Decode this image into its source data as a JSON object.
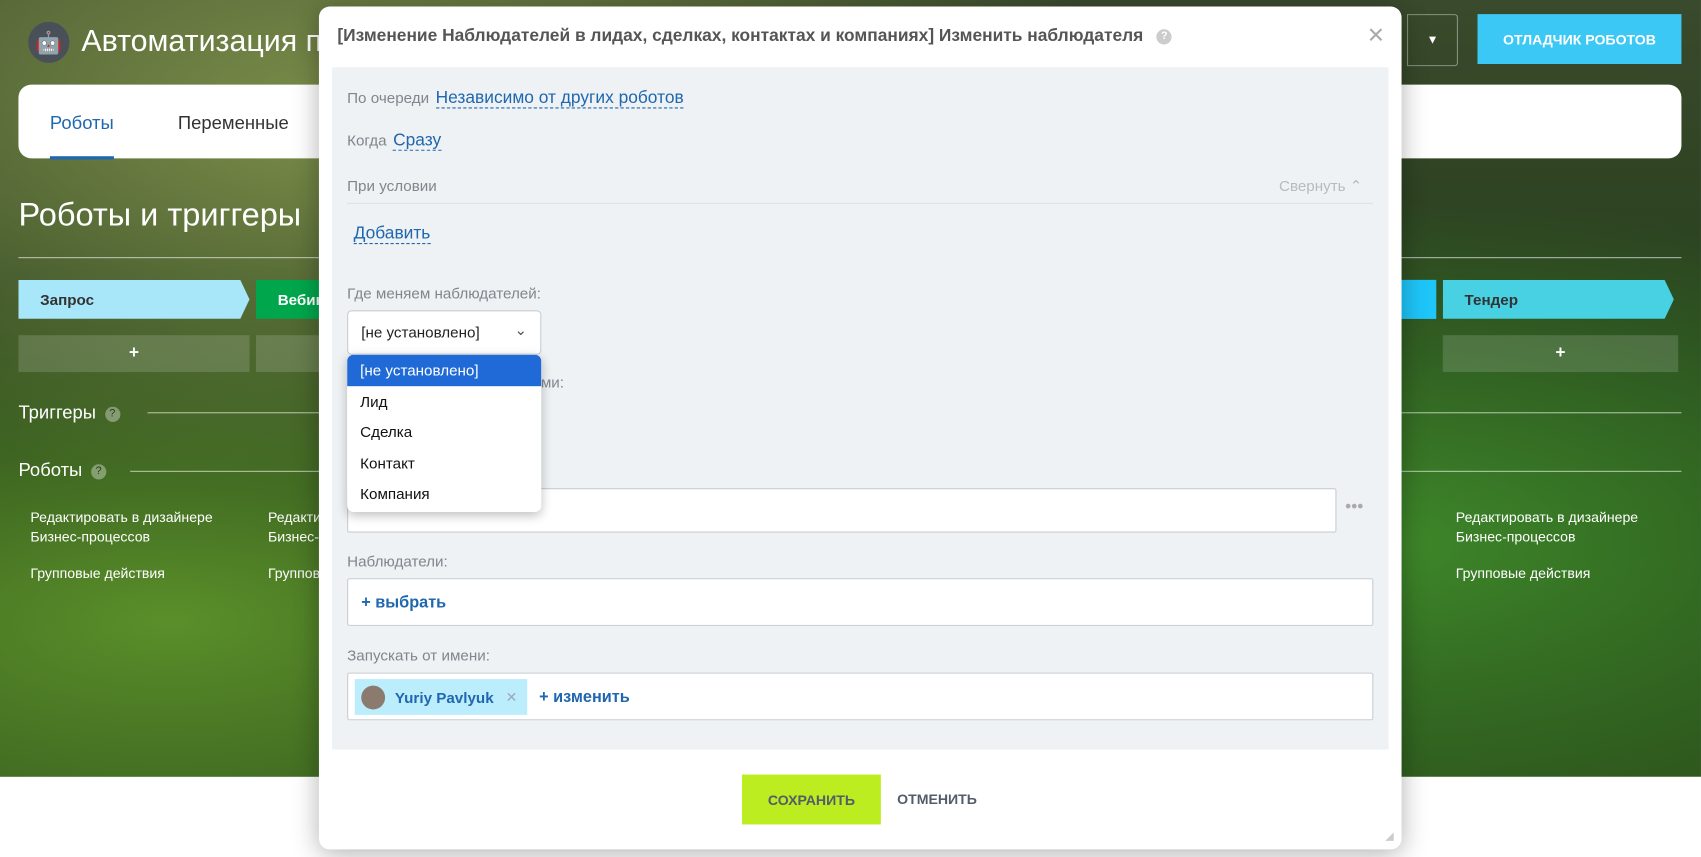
{
  "app": {
    "title": "Автоматизация пр",
    "debug_button": "ОТЛАДЧИК РОБОТОВ",
    "tabs": [
      "Роботы",
      "Переменные"
    ],
    "heading": "Роботы и триггеры"
  },
  "stages": [
    "Запрос",
    "Вебин",
    "Тендер"
  ],
  "sections": {
    "triggers": "Триггеры",
    "robots": "Роботы"
  },
  "column_links": {
    "edit": "Редактировать в дизайнере",
    "edit2": "Бизнес-процессов",
    "edit_cut": "Редакти",
    "edit2_cut": "Бизнес-п",
    "group": "Групповые действия",
    "group_cut": "Группов"
  },
  "modal": {
    "title": "[Изменение Наблюдателей в лидах, сделках, контактах и компаниях] Изменить наблюдателя",
    "queue_label": "По очереди",
    "queue_value": "Независимо от других роботов",
    "when_label": "Когда",
    "when_value": "Сразу",
    "condition_label": "При условии",
    "collapse": "Свернуть",
    "add": "Добавить",
    "where_label": "Где меняем наблюдателей:",
    "where_value": "[не установлено]",
    "options": [
      "[не установлено]",
      "Лид",
      "Сделка",
      "Контакт",
      "Компания"
    ],
    "hidden_label_tail": "ями:",
    "observers_label": "Наблюдатели:",
    "observers_add": "+ выбрать",
    "run_as_label": "Запускать от имени:",
    "run_as_user": "Yuriy Pavlyuk",
    "run_as_change": "+ изменить",
    "save": "СОХРАНИТЬ",
    "cancel": "ОТМЕНИТЬ"
  }
}
